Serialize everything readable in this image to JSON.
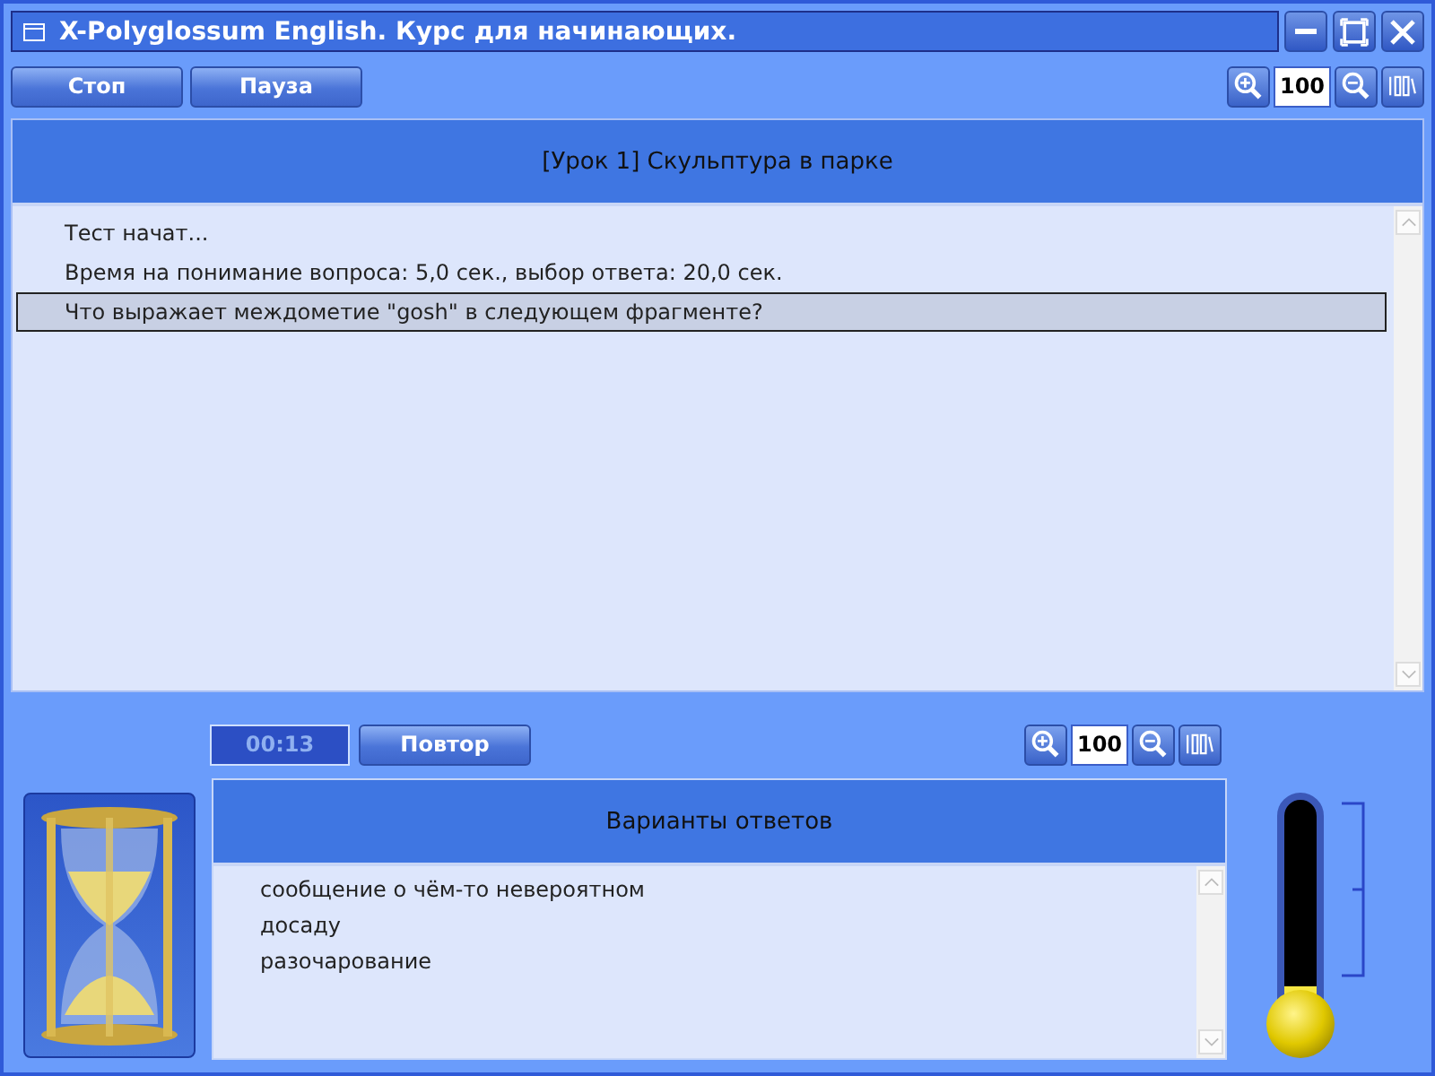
{
  "window": {
    "title": "X-Polyglossum English. Курс для начинающих."
  },
  "toolbar": {
    "buttons": [
      "Стоп",
      "Пауза"
    ],
    "zoom_value": "100"
  },
  "lesson": {
    "title": "[Урок 1] Скульптура в парке",
    "log": [
      {
        "text": "Тест начат...",
        "selected": false
      },
      {
        "text": "Время на понимание вопроса: 5,0 сек., выбор ответа: 20,0 сек.",
        "selected": false
      },
      {
        "text": "Что выражает междометие \"gosh\" в следующем фрагменте?",
        "selected": true
      }
    ]
  },
  "controls": {
    "timer": "00:13",
    "repeat_button": "Повтор",
    "zoom_value": "100"
  },
  "answers": {
    "title": "Варианты ответов",
    "options": [
      {
        "text": "сообщение о чём-то невероятном",
        "selected": false
      },
      {
        "text": "досаду",
        "selected": false
      },
      {
        "text": "разочарование",
        "selected": false
      }
    ]
  },
  "thermometer": {
    "level": 0.1
  }
}
